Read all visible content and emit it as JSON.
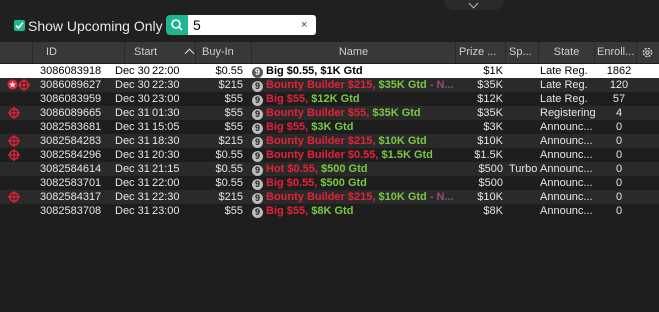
{
  "filter": {
    "show_upcoming_label": "Show Upcoming Only",
    "show_upcoming_checked": true,
    "search_value": "5",
    "clear_glyph": "×"
  },
  "columns": [
    {
      "key": "id",
      "label": "ID"
    },
    {
      "key": "start",
      "label": "Start"
    },
    {
      "key": "buyin",
      "label": "Buy-In"
    },
    {
      "key": "name",
      "label": "Name"
    },
    {
      "key": "prize",
      "label": "Prize ..."
    },
    {
      "key": "speed",
      "label": "Sp..."
    },
    {
      "key": "state",
      "label": "State"
    },
    {
      "key": "enrolled",
      "label": "Enroll..."
    }
  ],
  "game_badge": "9",
  "rows": [
    {
      "id": "3086083918",
      "date": "Dec 30",
      "time": "22:00",
      "buyin": "$0.55",
      "name": "Big $0.55,",
      "gtd": "$1K Gtd",
      "extra": "",
      "prize": "$1K",
      "speed": "",
      "state": "Late Reg.",
      "enrolled": "1862",
      "selected": true,
      "icons": []
    },
    {
      "id": "3086089627",
      "date": "Dec 30",
      "time": "22:30",
      "buyin": "$215",
      "name": "Bounty Builder $215,",
      "gtd": "$35K Gtd",
      "extra": " - N...",
      "prize": "$35K",
      "speed": "",
      "state": "Late Reg.",
      "enrolled": "120",
      "selected": false,
      "icons": [
        "star",
        "target"
      ]
    },
    {
      "id": "3086083959",
      "date": "Dec 30",
      "time": "23:00",
      "buyin": "$55",
      "name": "Big $55,",
      "gtd": "$12K Gtd",
      "extra": "",
      "prize": "$12K",
      "speed": "",
      "state": "Late Reg.",
      "enrolled": "57",
      "selected": false,
      "icons": []
    },
    {
      "id": "3086089665",
      "date": "Dec 31",
      "time": "01:30",
      "buyin": "$55",
      "name": "Bounty Builder $55,",
      "gtd": "$35K Gtd",
      "extra": "",
      "prize": "$35K",
      "speed": "",
      "state": "Registering",
      "enrolled": "4",
      "selected": false,
      "icons": [
        "target"
      ]
    },
    {
      "id": "3082583681",
      "date": "Dec 31",
      "time": "15:05",
      "buyin": "$55",
      "name": "Big $55,",
      "gtd": "$3K Gtd",
      "extra": "",
      "prize": "$3K",
      "speed": "",
      "state": "Announc...",
      "enrolled": "0",
      "selected": false,
      "icons": []
    },
    {
      "id": "3082584283",
      "date": "Dec 31",
      "time": "18:30",
      "buyin": "$215",
      "name": "Bounty Builder $215,",
      "gtd": "$10K Gtd",
      "extra": "",
      "prize": "$10K",
      "speed": "",
      "state": "Announc...",
      "enrolled": "0",
      "selected": false,
      "icons": [
        "target"
      ]
    },
    {
      "id": "3082584296",
      "date": "Dec 31",
      "time": "20:30",
      "buyin": "$0.55",
      "name": "Bounty Builder $0.55,",
      "gtd": "$1.5K Gtd",
      "extra": "",
      "prize": "$1.5K",
      "speed": "",
      "state": "Announc...",
      "enrolled": "0",
      "selected": false,
      "icons": [
        "target"
      ]
    },
    {
      "id": "3082584614",
      "date": "Dec 31",
      "time": "21:15",
      "buyin": "$0.55",
      "name": "Hot $0.55,",
      "gtd": "$500 Gtd",
      "extra": "",
      "prize": "$500",
      "speed": "Turbo",
      "state": "Announc...",
      "enrolled": "0",
      "selected": false,
      "icons": []
    },
    {
      "id": "3082583701",
      "date": "Dec 31",
      "time": "22:00",
      "buyin": "$0.55",
      "name": "Big $0.55,",
      "gtd": "$500 Gtd",
      "extra": "",
      "prize": "$500",
      "speed": "",
      "state": "Announc...",
      "enrolled": "0",
      "selected": false,
      "icons": []
    },
    {
      "id": "3082584317",
      "date": "Dec 31",
      "time": "22:30",
      "buyin": "$215",
      "name": "Bounty Builder $215,",
      "gtd": "$10K Gtd",
      "extra": " - N...",
      "prize": "$10K",
      "speed": "",
      "state": "Announc...",
      "enrolled": "0",
      "selected": false,
      "icons": [
        "target"
      ]
    },
    {
      "id": "3082583708",
      "date": "Dec 31",
      "time": "23:00",
      "buyin": "$55",
      "name": "Big $55,",
      "gtd": "$8K Gtd",
      "extra": "",
      "prize": "$8K",
      "speed": "",
      "state": "Announc...",
      "enrolled": "0",
      "selected": false,
      "icons": []
    }
  ],
  "colors": {
    "accent": "#1fb58f",
    "name_red": "#e4223a",
    "gtd_green": "#7ac943",
    "extra_purple": "#9a4b7a"
  }
}
